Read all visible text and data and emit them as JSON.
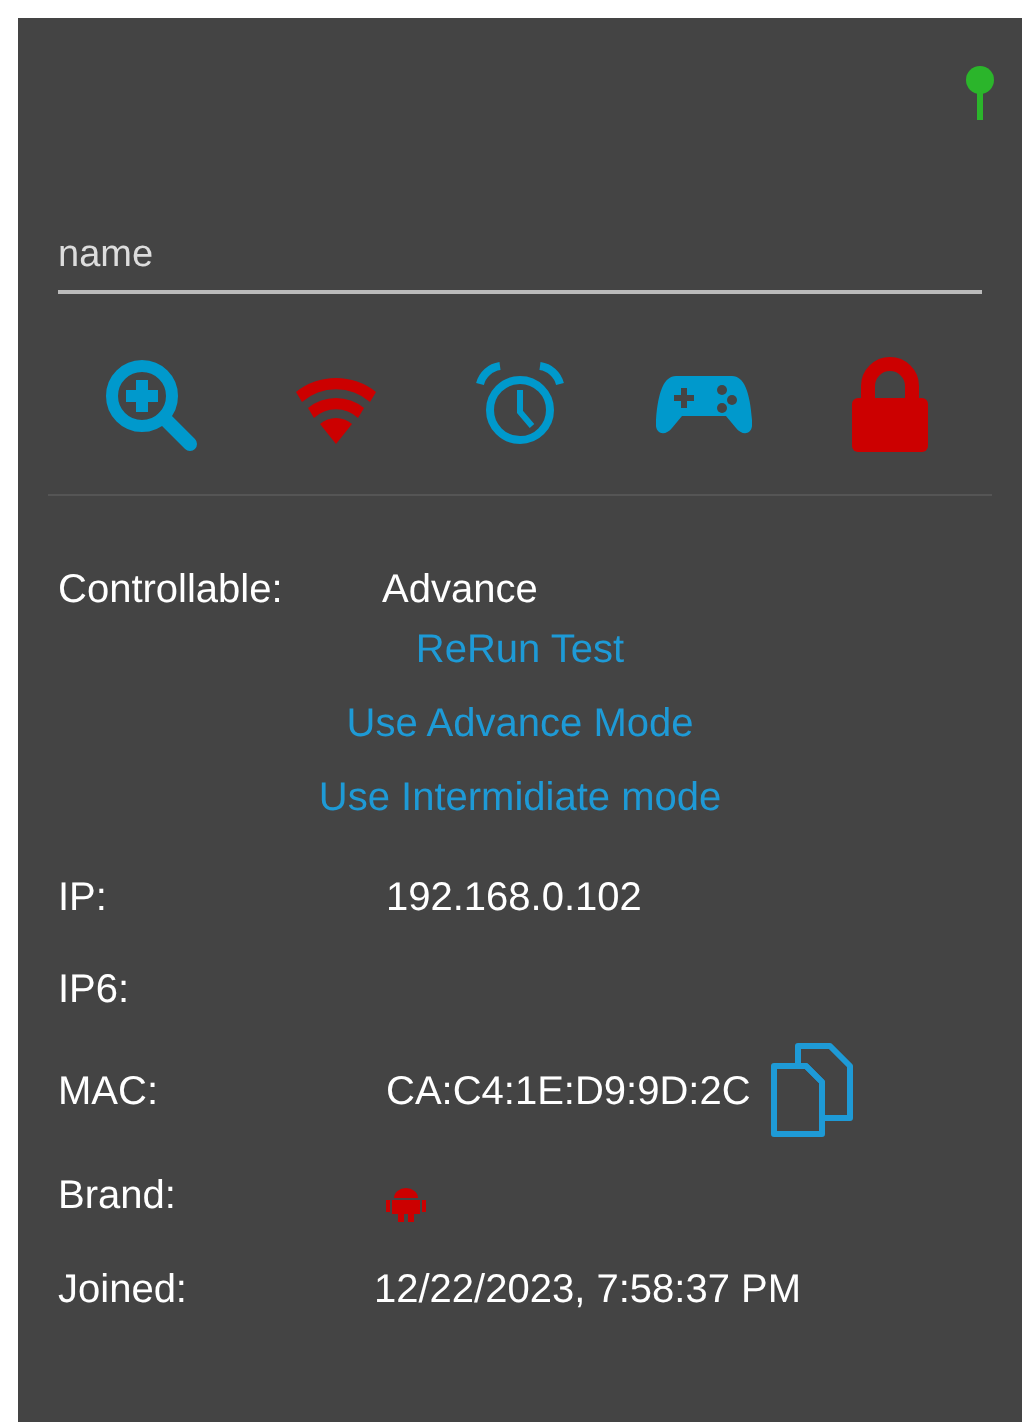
{
  "status_pin": {
    "color": "#2bb52b"
  },
  "name_field": {
    "placeholder": "name"
  },
  "actions": [
    {
      "kind": "zoom",
      "color": "#0099cc"
    },
    {
      "kind": "wifi",
      "color": "#cc0000"
    },
    {
      "kind": "alarm",
      "color": "#0099cc"
    },
    {
      "kind": "gamepad",
      "color": "#0099cc"
    },
    {
      "kind": "lock",
      "color": "#cc0000"
    }
  ],
  "controllable": {
    "label": "Controllable:",
    "value": "Advance"
  },
  "links": [
    "ReRun Test",
    "Use Advance Mode",
    "Use Intermidiate mode"
  ],
  "details": [
    {
      "kind": "text",
      "label": "IP:",
      "value": "192.168.0.102"
    },
    {
      "kind": "text",
      "label": "IP6:"
    },
    {
      "kind": "copy",
      "label": "MAC:",
      "value": "CA:C4:1E:D9:9D:2C"
    },
    {
      "kind": "robot",
      "label": "Brand:",
      "color": "#cc0000"
    },
    {
      "kind": "text",
      "label": "Joined:",
      "value": "12/22/2023, 7:58:37 PM"
    }
  ]
}
